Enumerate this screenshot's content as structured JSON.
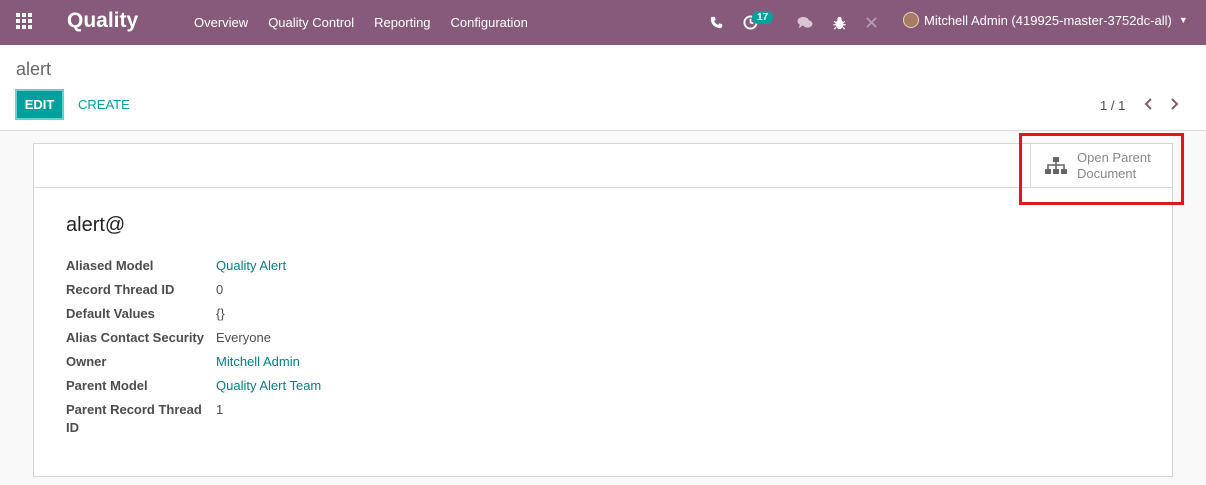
{
  "navbar": {
    "brand": "Quality",
    "menu": [
      "Overview",
      "Quality Control",
      "Reporting",
      "Configuration"
    ],
    "activity_count": "17",
    "user": "Mitchell Admin (419925-master-3752dc-all)",
    "colors": {
      "bar": "#875a7b",
      "accent": "#00a09d"
    }
  },
  "control_panel": {
    "breadcrumb": "alert",
    "edit_label": "EDIT",
    "create_label": "CREATE",
    "pager": "1 / 1"
  },
  "sheet": {
    "smart_button_line1": "Open Parent",
    "smart_button_line2": "Document",
    "title": "alert@",
    "fields": [
      {
        "label": "Aliased Model",
        "value": "Quality Alert",
        "link": true
      },
      {
        "label": "Record Thread ID",
        "value": "0",
        "link": false
      },
      {
        "label": "Default Values",
        "value": "{}",
        "link": false
      },
      {
        "label": "Alias Contact Security",
        "value": "Everyone",
        "link": false
      },
      {
        "label": "Owner",
        "value": "Mitchell Admin",
        "link": true
      },
      {
        "label": "Parent Model",
        "value": "Quality Alert Team",
        "link": true
      },
      {
        "label": "Parent Record Thread ID",
        "value": "1",
        "link": false
      }
    ]
  }
}
